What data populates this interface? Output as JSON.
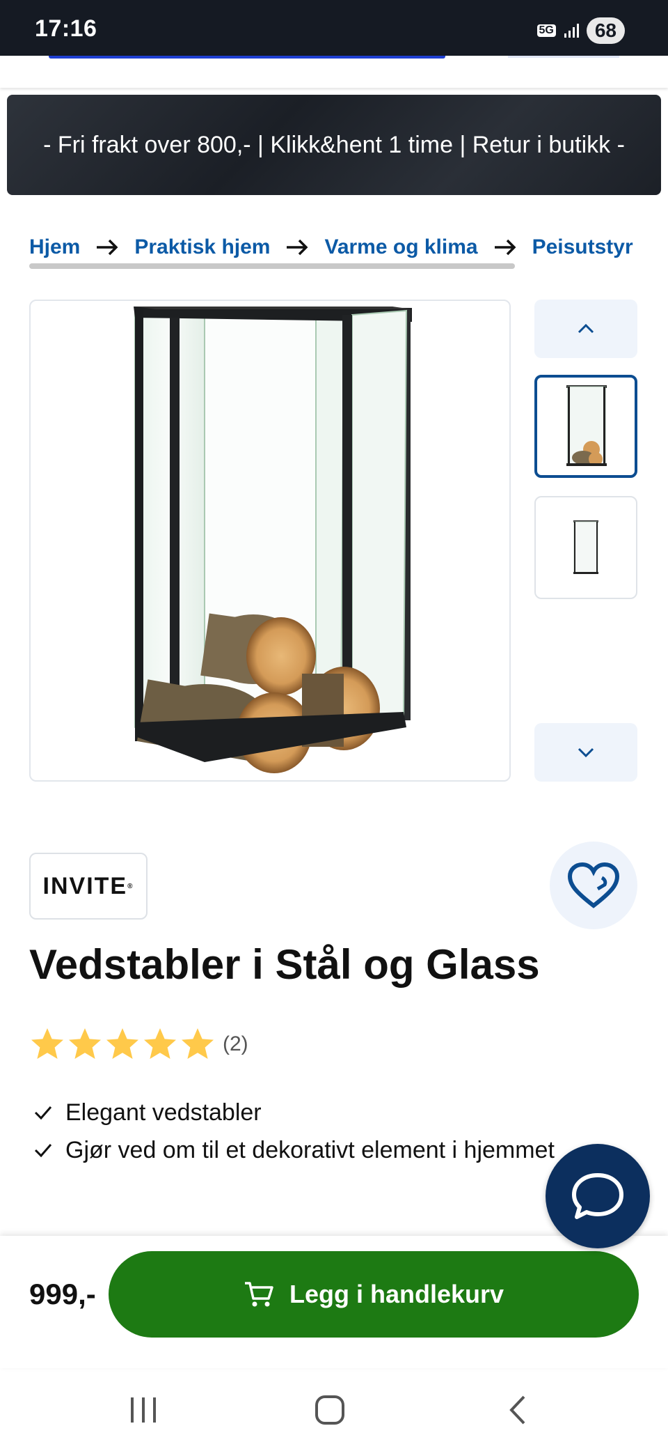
{
  "status_bar": {
    "time": "17:16",
    "network": "5G",
    "battery": "68"
  },
  "banner": {
    "text": "- Fri frakt over 800,- | Klikk&hent 1 time | Retur i butikk -"
  },
  "breadcrumb": [
    "Hjem",
    "Praktisk hjem",
    "Varme og klima",
    "Peisutstyr"
  ],
  "gallery": {
    "main_alt": "Vedstabler i Stål og Glass",
    "up_icon": "chevron-up-icon",
    "down_icon": "chevron-down-icon",
    "thumbnails": [
      "thumbnail-1-logs",
      "thumbnail-2-empty"
    ]
  },
  "product": {
    "brand": "INVITE",
    "title": "Vedstabler i Stål og Glass",
    "rating": 5,
    "review_count": "(2)",
    "features": [
      "Elegant vedstabler",
      "Gjør ved om til et dekorativt element i hjemmet"
    ]
  },
  "purchase": {
    "price": "999,-",
    "cart_label": "Legg i handlekurv"
  },
  "colors": {
    "primary_blue": "#0c5aa6",
    "cart_green": "#1d7a13",
    "chat_navy": "#0c2f5e",
    "star": "#ffc94a"
  }
}
